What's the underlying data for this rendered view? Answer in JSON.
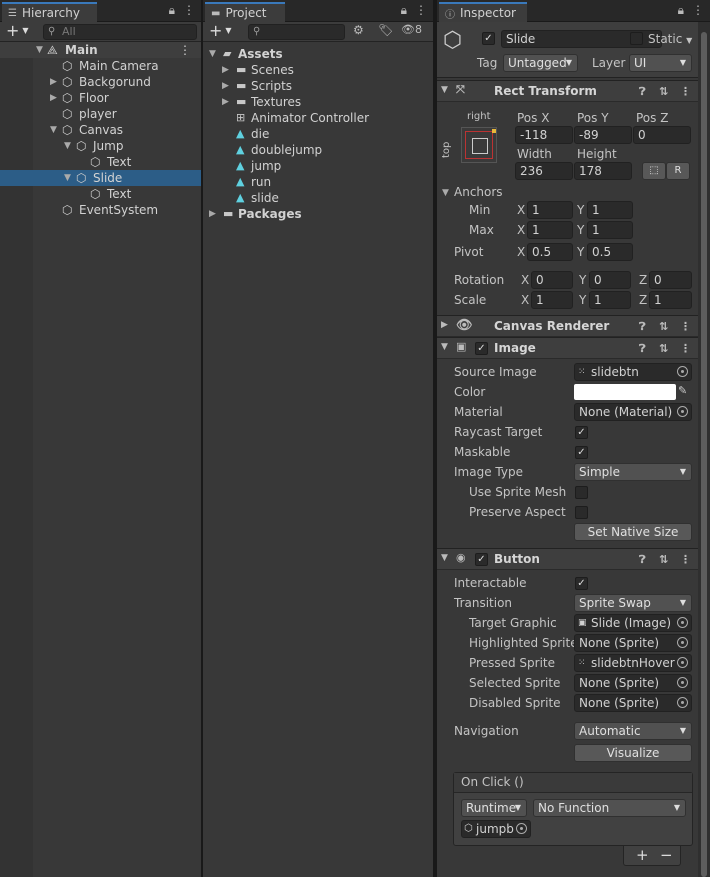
{
  "hierarchy": {
    "tab": "Hierarchy",
    "search_placeholder": "All",
    "scene": "Main",
    "items": [
      {
        "label": "Main Camera"
      },
      {
        "label": "Backgorund"
      },
      {
        "label": "Floor"
      },
      {
        "label": "player"
      },
      {
        "label": "Canvas"
      },
      {
        "label": "Jump"
      },
      {
        "label": "Text"
      },
      {
        "label": "Slide"
      },
      {
        "label": "Text"
      },
      {
        "label": "EventSystem"
      }
    ]
  },
  "project": {
    "tab": "Project",
    "hidden_count": "8",
    "root": "Assets",
    "folders": [
      "Scenes",
      "Scripts",
      "Textures"
    ],
    "assets": [
      "Animator Controller",
      "die",
      "doublejump",
      "jump",
      "run",
      "slide"
    ],
    "packages": "Packages"
  },
  "inspector": {
    "tab": "Inspector",
    "object_name": "Slide",
    "static_label": "Static",
    "tag_label": "Tag",
    "tag_value": "Untagged",
    "layer_label": "Layer",
    "layer_value": "UI",
    "rect_transform": {
      "title": "Rect Transform",
      "anchor_h": "right",
      "anchor_v": "top",
      "pos_x_label": "Pos X",
      "pos_x": "-118",
      "pos_y_label": "Pos Y",
      "pos_y": "-89",
      "pos_z_label": "Pos Z",
      "pos_z": "0",
      "width_label": "Width",
      "width": "236",
      "height_label": "Height",
      "height": "178",
      "r_button": "R",
      "anchors_label": "Anchors",
      "min_label": "Min",
      "min_x": "1",
      "min_y": "1",
      "max_label": "Max",
      "max_x": "1",
      "max_y": "1",
      "pivot_label": "Pivot",
      "pivot_x": "0.5",
      "pivot_y": "0.5",
      "rotation_label": "Rotation",
      "rot_x": "0",
      "rot_y": "0",
      "rot_z": "0",
      "scale_label": "Scale",
      "scale_x": "1",
      "scale_y": "1",
      "scale_z": "1",
      "x": "X",
      "y": "Y",
      "z": "Z"
    },
    "canvas_renderer": {
      "title": "Canvas Renderer"
    },
    "image": {
      "title": "Image",
      "source_image_label": "Source Image",
      "source_image": "slidebtn",
      "color_label": "Color",
      "color_value": "#ffffff",
      "material_label": "Material",
      "material": "None (Material)",
      "raycast_label": "Raycast Target",
      "maskable_label": "Maskable",
      "image_type_label": "Image Type",
      "image_type": "Simple",
      "sprite_mesh_label": "Use Sprite Mesh",
      "preserve_label": "Preserve Aspect",
      "native_size_button": "Set Native Size"
    },
    "button": {
      "title": "Button",
      "interactable_label": "Interactable",
      "transition_label": "Transition",
      "transition": "Sprite Swap",
      "target_graphic_label": "Target Graphic",
      "target_graphic": "Slide (Image)",
      "highlighted_label": "Highlighted Sprite",
      "highlighted": "None (Sprite)",
      "pressed_label": "Pressed Sprite",
      "pressed": "slidebtnHover",
      "selected_label": "Selected Sprite",
      "selected": "None (Sprite)",
      "disabled_label": "Disabled Sprite",
      "disabled": "None (Sprite)",
      "navigation_label": "Navigation",
      "navigation": "Automatic",
      "visualize_button": "Visualize",
      "onclick_title": "On Click ()",
      "runtime": "Runtime",
      "function": "No Function",
      "object": "jumpb",
      "add": "+",
      "remove": "−"
    }
  },
  "colors": {
    "accent": "#3a79bb",
    "selection": "#2c5d87",
    "panel": "#383838"
  }
}
